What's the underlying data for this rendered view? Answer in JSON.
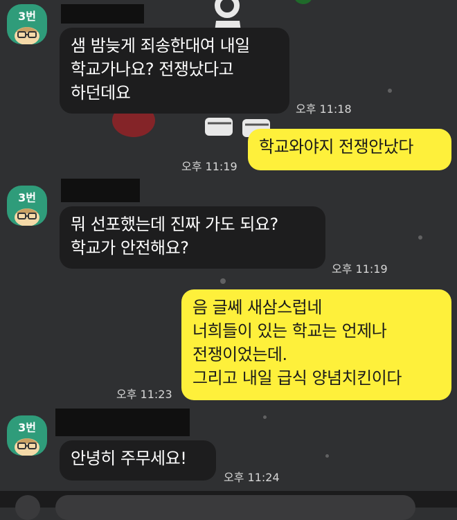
{
  "chat": {
    "messages": [
      {
        "sender_label": "3번",
        "lines": [
          "샘 밤늦게 죄송한대여 내일",
          "학교가나요? 전쟁났다고",
          "하던데요"
        ],
        "time": "오후 11:18"
      },
      {
        "lines": [
          "학교와야지 전쟁안났다"
        ],
        "time": "오후 11:19"
      },
      {
        "sender_label": "3번",
        "lines": [
          "뭐 선포했는데 진짜 가도 되요?",
          "학교가 안전해요?"
        ],
        "time": "오후 11:19"
      },
      {
        "lines": [
          "음 글쎄 새삼스럽네",
          "너희들이 있는 학교는 언제나",
          "전쟁이었는데.",
          "그리고 내일 급식  양념치킨이다"
        ],
        "time": "오후 11:23"
      },
      {
        "sender_label": "3번",
        "lines": [
          "안녕히 주무세요!"
        ],
        "time": "오후 11:24"
      }
    ]
  },
  "colors": {
    "background": "#2f3032",
    "incoming_bubble": "#1d1d1e",
    "outgoing_bubble": "#fef03b",
    "avatar": "#2f9c7a"
  }
}
